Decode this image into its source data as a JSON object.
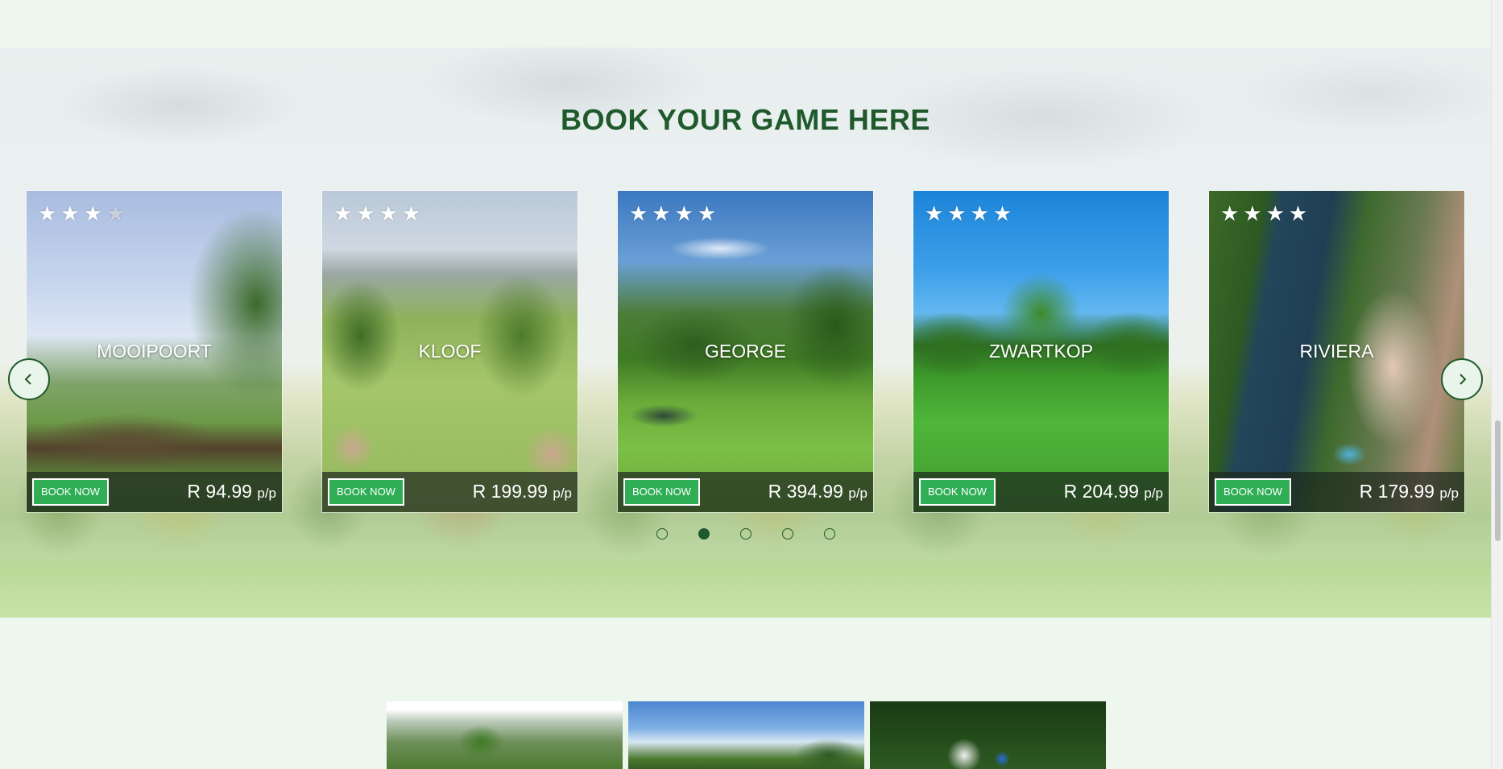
{
  "section": {
    "title": "BOOK YOUR GAME HERE"
  },
  "carousel": {
    "prev_icon": "chevron-left-icon",
    "next_icon": "chevron-right-icon",
    "active_index": 1,
    "dot_count": 5,
    "courses": [
      {
        "name": "MOOIPOORT",
        "rating": 3.5,
        "button": "BOOK NOW",
        "price": "R 94.99",
        "unit": "p/p"
      },
      {
        "name": "KLOOF",
        "rating": 4,
        "button": "BOOK NOW",
        "price": "R 199.99",
        "unit": "p/p"
      },
      {
        "name": "GEORGE",
        "rating": 4,
        "button": "BOOK NOW",
        "price": "R 394.99",
        "unit": "p/p"
      },
      {
        "name": "ZWARTKOP",
        "rating": 4,
        "button": "BOOK NOW",
        "price": "R 204.99",
        "unit": "p/p"
      },
      {
        "name": "RIVIERA",
        "rating": 4,
        "button": "BOOK NOW",
        "price": "R 179.99",
        "unit": "p/p"
      }
    ]
  },
  "colors": {
    "page_bg": "#edf7ee",
    "title": "#1f5a2c",
    "button": "#2fae55",
    "footer_overlay": "rgba(30,40,30,0.72)"
  }
}
